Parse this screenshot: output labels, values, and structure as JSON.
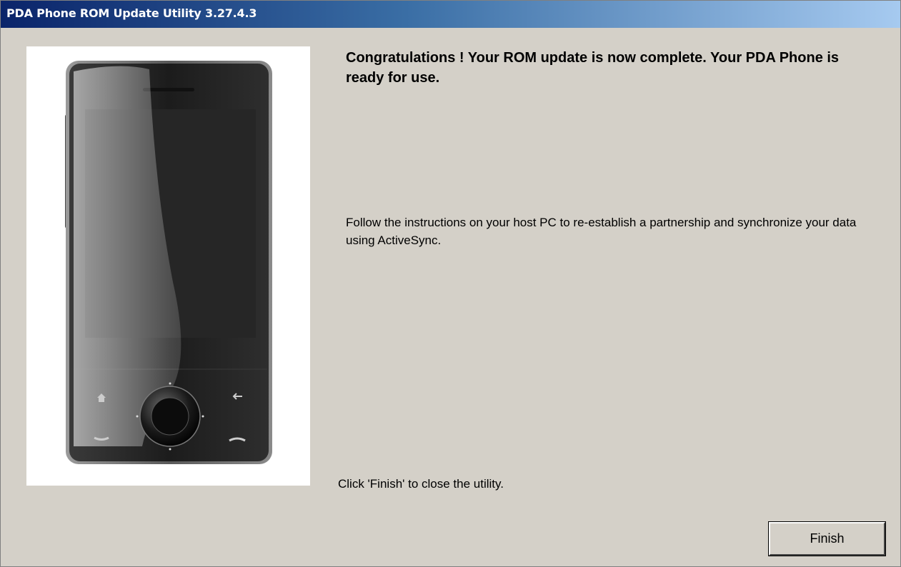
{
  "window": {
    "title": "PDA Phone ROM Update Utility 3.27.4.3"
  },
  "content": {
    "heading": "Congratulations ! Your ROM update is now complete. Your PDA Phone is ready for use.",
    "instructions": "Follow the instructions on your host PC to re-establish a partnership and synchronize your data using ActiveSync.",
    "finish_hint": "Click 'Finish' to close the utility."
  },
  "buttons": {
    "finish_label": "Finish"
  },
  "illustration": {
    "name": "pda-phone-illustration",
    "icons": [
      "home-icon",
      "back-icon",
      "call-icon",
      "end-call-icon",
      "navigation-wheel-icon"
    ]
  },
  "colors": {
    "dialog_background": "#d4d0c8",
    "titlebar_start": "#0a246a",
    "titlebar_end": "#a6caf0",
    "title_text": "#ffffff"
  }
}
